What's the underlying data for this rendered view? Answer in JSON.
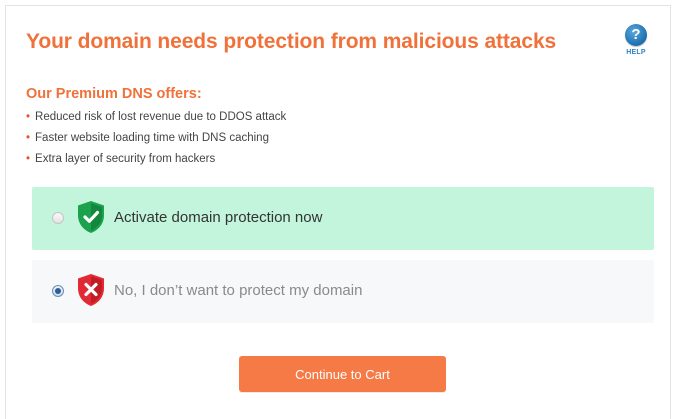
{
  "header": {
    "title": "Your domain needs protection from malicious attacks",
    "help_label": "HELP",
    "help_icon": "question-circle-icon",
    "help_glyph": "?"
  },
  "offer": {
    "subtitle": "Our Premium DNS offers:",
    "bullet_glyph": "•",
    "features": [
      "Reduced risk of lost revenue due to DDOS attack",
      "Faster website loading time with DNS caching",
      "Extra layer of security from hackers"
    ]
  },
  "options": [
    {
      "label": "Activate domain protection now",
      "icon": "shield-check-icon",
      "selected": false,
      "background": "#c3f5dc",
      "icon_color": "#1aa24c"
    },
    {
      "label": "No, I don’t want to protect my domain",
      "icon": "shield-x-icon",
      "selected": true,
      "background": "#f7f8fa",
      "icon_color": "#e12a34"
    }
  ],
  "cta": {
    "label": "Continue to Cart",
    "color": "#f57a45"
  },
  "colors": {
    "accent": "#f0713a",
    "help_blue": "#1b6fae"
  }
}
